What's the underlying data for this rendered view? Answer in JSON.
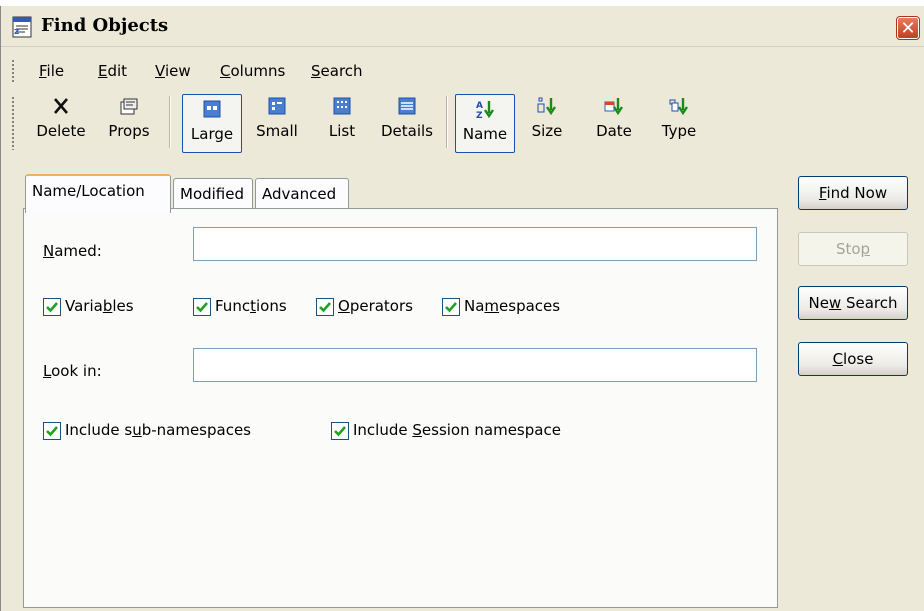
{
  "window": {
    "title": "Find Objects",
    "close_glyph": "✕"
  },
  "menu": [
    {
      "label": "File",
      "mnemonic": "F",
      "rest": "ile"
    },
    {
      "label": "Edit",
      "mnemonic": "E",
      "rest": "dit"
    },
    {
      "label": "View",
      "mnemonic": "V",
      "rest": "iew"
    },
    {
      "label": "Columns",
      "mnemonic": "C",
      "rest": "olumns"
    },
    {
      "label": "Search",
      "mnemonic": "S",
      "rest": "earch"
    }
  ],
  "toolbar": {
    "delete": "Delete",
    "props": "Props",
    "large": "Large",
    "small": "Small",
    "list": "List",
    "details": "Details",
    "name": "Name",
    "size": "Size",
    "date": "Date",
    "type": "Type"
  },
  "tabs": [
    "Name/Location",
    "Modified",
    "Advanced"
  ],
  "form": {
    "named_pre": "",
    "named_mn": "N",
    "named_post": "amed:",
    "named_value": "",
    "lookin_pre": "",
    "lookin_mn": "L",
    "lookin_post": "ook in:",
    "lookin_value": "",
    "checks": {
      "variables": {
        "pre": "Varia",
        "mn": "b",
        "post": "les",
        "checked": true
      },
      "functions": {
        "pre": "Func",
        "mn": "t",
        "post": "ions",
        "checked": true
      },
      "operators": {
        "pre": "",
        "mn": "O",
        "post": "perators",
        "checked": true
      },
      "namespaces": {
        "pre": "Na",
        "mn": "m",
        "post": "espaces",
        "checked": true
      },
      "subns": {
        "pre": "Include s",
        "mn": "u",
        "post": "b-namespaces",
        "checked": true
      },
      "session": {
        "pre": "Include ",
        "mn": "S",
        "post": "ession namespace",
        "checked": true
      }
    }
  },
  "buttons": {
    "find_pre": "",
    "find_mn": "F",
    "find_post": "ind Now",
    "stop_pre": "Sto",
    "stop_mn": "p",
    "stop_post": "",
    "new_pre": "Ne",
    "new_mn": "w",
    "new_post": " Search",
    "close_pre": "",
    "close_mn": "C",
    "close_post": "lose"
  },
  "colors": {
    "check": "#21a121",
    "accent": "#003c74",
    "tab_highlight": "#f0b060"
  }
}
